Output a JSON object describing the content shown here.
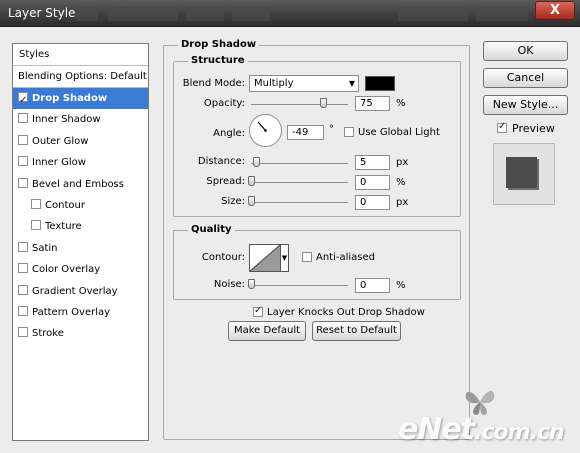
{
  "window": {
    "title": "Layer Style",
    "close_label": "X"
  },
  "sidebar": {
    "header": "Styles",
    "blending": "Blending Options: Default",
    "items": [
      {
        "label": "Drop Shadow",
        "checked": true,
        "selected": true
      },
      {
        "label": "Inner Shadow",
        "checked": false
      },
      {
        "label": "Outer Glow",
        "checked": false
      },
      {
        "label": "Inner Glow",
        "checked": false
      },
      {
        "label": "Bevel and Emboss",
        "checked": false
      },
      {
        "label": "Contour",
        "checked": false,
        "indent": true
      },
      {
        "label": "Texture",
        "checked": false,
        "indent": true
      },
      {
        "label": "Satin",
        "checked": false
      },
      {
        "label": "Color Overlay",
        "checked": false
      },
      {
        "label": "Gradient Overlay",
        "checked": false
      },
      {
        "label": "Pattern Overlay",
        "checked": false
      },
      {
        "label": "Stroke",
        "checked": false
      }
    ]
  },
  "drop_shadow": {
    "title": "Drop Shadow",
    "structure": {
      "title": "Structure",
      "blend_mode_label": "Blend Mode:",
      "blend_mode_value": "Multiply",
      "shadow_color": "#000000",
      "opacity_label": "Opacity:",
      "opacity_value": "75",
      "opacity_unit": "%",
      "opacity_level": 0.75,
      "angle_label": "Angle:",
      "angle_value": "-49",
      "angle_unit": "°",
      "use_global_light_label": "Use Global Light",
      "distance_label": "Distance:",
      "distance_value": "5",
      "distance_unit": "px",
      "spread_label": "Spread:",
      "spread_value": "0",
      "spread_unit": "%",
      "size_label": "Size:",
      "size_value": "0",
      "size_unit": "px"
    },
    "quality": {
      "title": "Quality",
      "contour_label": "Contour:",
      "anti_aliased_label": "Anti-aliased",
      "noise_label": "Noise:",
      "noise_value": "0",
      "noise_unit": "%"
    },
    "knockout_label": "Layer Knocks Out Drop Shadow",
    "make_default_label": "Make Default",
    "reset_default_label": "Reset to Default"
  },
  "actions": {
    "ok_label": "OK",
    "cancel_label": "Cancel",
    "new_style_label": "New Style...",
    "preview_label": "Preview"
  },
  "watermark": {
    "main": "eNet",
    "suffix": ".com.cn"
  }
}
